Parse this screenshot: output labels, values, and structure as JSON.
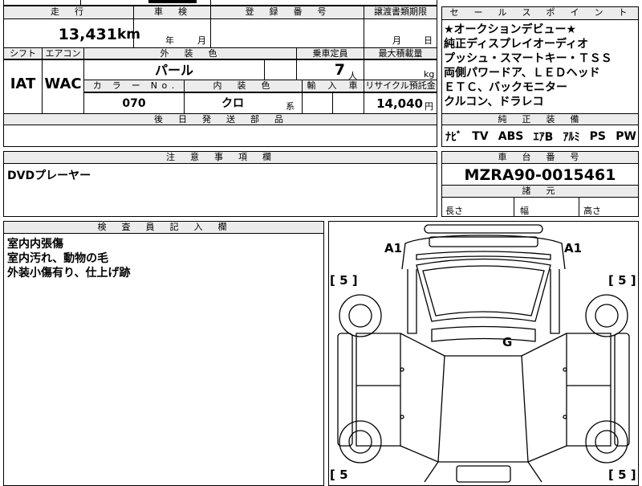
{
  "sheet": {
    "top_left_partial": "",
    "mileage_header": "走　行",
    "mileage_value": "13,431",
    "mileage_unit": "km",
    "inspection_header": "車　検",
    "inspection_year": "年",
    "inspection_month": "月",
    "registration_header": "登　録　番　号",
    "transfer_header": "譲渡書類期限",
    "transfer_month": "月",
    "transfer_day": "日",
    "shift_header": "シフト",
    "aircon_header": "エアコン",
    "exterior_color_header": "外　装　色",
    "capacity_header": "乗車定員",
    "max_load_header": "最大積載量",
    "shift_value": "IAT",
    "aircon_value": "WAC",
    "exterior_color_value": "パール",
    "capacity_value": "7",
    "capacity_unit": "人",
    "max_load_unit": "kg",
    "color_no_header": "カ　ラ　ー　N o .",
    "interior_color_header": "内　装　色",
    "import_header": "輸　入　車",
    "recycle_header": "リサイクル預託金",
    "color_no_value": "070",
    "interior_color_value": "クロ",
    "interior_color_suffix": "系",
    "recycle_value": "14,040",
    "recycle_unit": "円",
    "later_parts_header": "後　日　発　送　部　品"
  },
  "sales_points": {
    "header": "セ　ー　ル　ス　ポ　イ　ン　ト",
    "lines": [
      "★オークションデビュー★",
      "純正ディスプレイオーディオ",
      "プッシュ・スマートキー・ＴＳＳ",
      "両側パワードア、ＬＥＤヘッド",
      "ＥＴＣ、バックモニター",
      "クルコン、ドラレコ"
    ]
  },
  "equipment": {
    "header": "純　正　装　備",
    "items": [
      "ﾅﾋﾞ",
      "TV",
      "ABS",
      "ｴｱB",
      "ｱﾙﾐ",
      "PS",
      "PW"
    ]
  },
  "notes": {
    "header": "注　意　事　項　欄",
    "text": "DVDプレーヤー"
  },
  "chassis": {
    "header": "車　台　番　号",
    "value": "MZRA90-0015461",
    "dims_header": "諸　元",
    "length_label": "長さ",
    "width_label": "幅",
    "height_label": "高さ"
  },
  "inspector": {
    "header": "検　査　員　記　入　欄",
    "lines": [
      "室内内張傷",
      "室内汚れ、動物の毛",
      "外装小傷有り、仕上げ跡"
    ]
  },
  "diagram": {
    "a1_left": "A1",
    "a1_right": "A1",
    "g_mark": "G",
    "tire_tl": "[ 5 ]",
    "tire_tr": "[ 5 ]",
    "tire_bl": "[ 5",
    "tire_br": "[ 5 ]"
  }
}
